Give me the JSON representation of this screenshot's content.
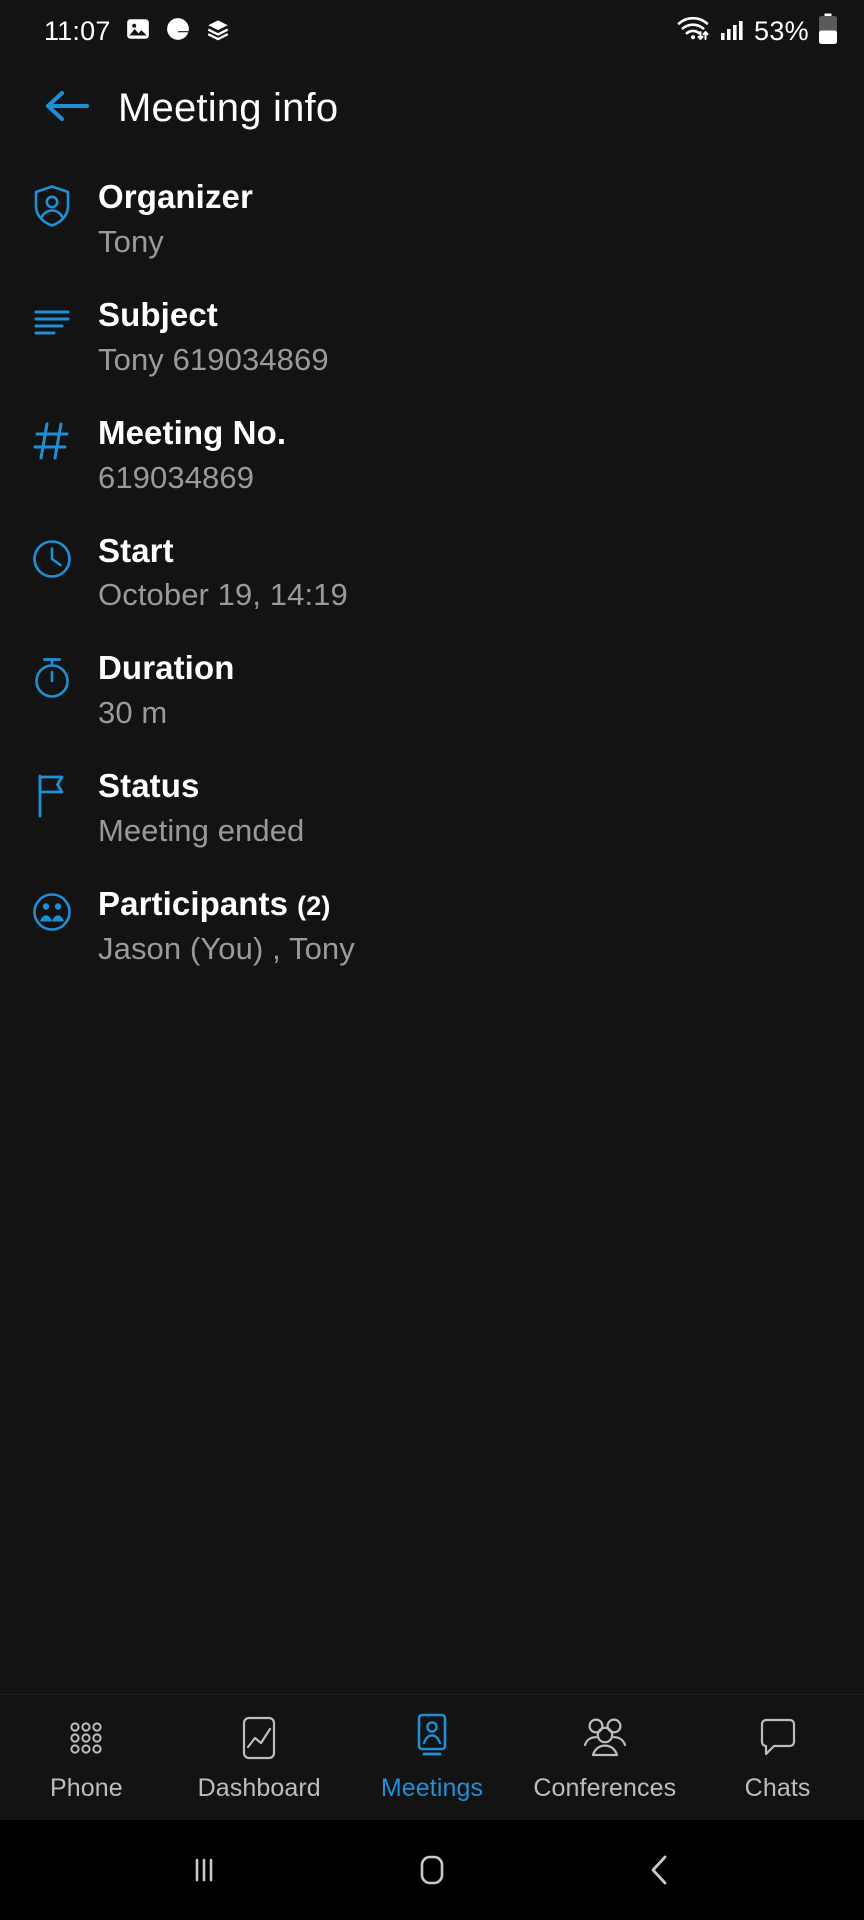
{
  "status_bar": {
    "time": "11:07",
    "left_icons": [
      "image-icon",
      "google-g-icon",
      "layers-icon"
    ],
    "right_icons": [
      "wifi-icon",
      "cellular-signal-icon",
      "battery-icon"
    ],
    "battery_percent": "53%"
  },
  "header": {
    "back_icon": "arrow-left-icon",
    "title": "Meeting info"
  },
  "colors": {
    "accent": "#1f8fd6",
    "background": "#131313",
    "label": "#ffffff",
    "value": "#9a9a9a",
    "navbar_background": "#000000"
  },
  "info": {
    "rows": [
      {
        "icon": "shield-person-icon",
        "label": "Organizer",
        "count": "",
        "value": "Tony"
      },
      {
        "icon": "text-lines-icon",
        "label": "Subject",
        "count": "",
        "value": "Tony 619034869"
      },
      {
        "icon": "hash-icon",
        "label": "Meeting No.",
        "count": "",
        "value": "619034869"
      },
      {
        "icon": "clock-icon",
        "label": "Start",
        "count": "",
        "value": "October 19, 14:19"
      },
      {
        "icon": "stopwatch-icon",
        "label": "Duration",
        "count": "",
        "value": "30 m"
      },
      {
        "icon": "flag-icon",
        "label": "Status",
        "count": "",
        "value": "Meeting ended"
      },
      {
        "icon": "participants-icon",
        "label": "Participants",
        "count": "(2)",
        "value": "Jason (You) , Tony"
      }
    ]
  },
  "tabbar": {
    "tabs": [
      {
        "icon": "keypad-icon",
        "label": "Phone",
        "active": false
      },
      {
        "icon": "chart-icon",
        "label": "Dashboard",
        "active": false
      },
      {
        "icon": "meeting-icon",
        "label": "Meetings",
        "active": true
      },
      {
        "icon": "group-icon",
        "label": "Conferences",
        "active": false
      },
      {
        "icon": "chat-bubble-icon",
        "label": "Chats",
        "active": false
      }
    ]
  },
  "navbar": {
    "buttons": [
      {
        "icon": "recents-icon",
        "label": "Recents"
      },
      {
        "icon": "home-icon",
        "label": "Home"
      },
      {
        "icon": "back-icon",
        "label": "Back"
      }
    ]
  }
}
